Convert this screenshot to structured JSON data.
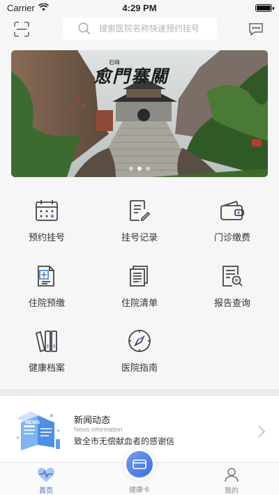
{
  "status_bar": {
    "carrier": "Carrier",
    "time": "4:29 PM"
  },
  "search": {
    "placeholder": "搜索医院名称快速预约挂号"
  },
  "banner": {
    "calligraphy": "愈門寨關",
    "small_text": "石峰",
    "slide_count": 3,
    "active_slide": 1
  },
  "grid": [
    {
      "label": "预约挂号",
      "icon": "calendar-icon"
    },
    {
      "label": "挂号记录",
      "icon": "edit-record-icon"
    },
    {
      "label": "门诊缴费",
      "icon": "wallet-icon"
    },
    {
      "label": "住院预缴",
      "icon": "hospital-prepay-icon"
    },
    {
      "label": "住院清单",
      "icon": "document-list-icon"
    },
    {
      "label": "报告查询",
      "icon": "report-search-icon"
    },
    {
      "label": "健康档案",
      "icon": "binders-icon"
    },
    {
      "label": "医院指南",
      "icon": "compass-icon"
    }
  ],
  "news": {
    "title": "新闻动态",
    "subtitle": "News information",
    "headline": "致全市无偿献血者的感谢信",
    "image_tag": "NEWS"
  },
  "tabbar": {
    "home": "首页",
    "card": "健康卡",
    "mine": "我的"
  },
  "colors": {
    "accent": "#3f6ed8",
    "background": "#f6f6f6"
  }
}
